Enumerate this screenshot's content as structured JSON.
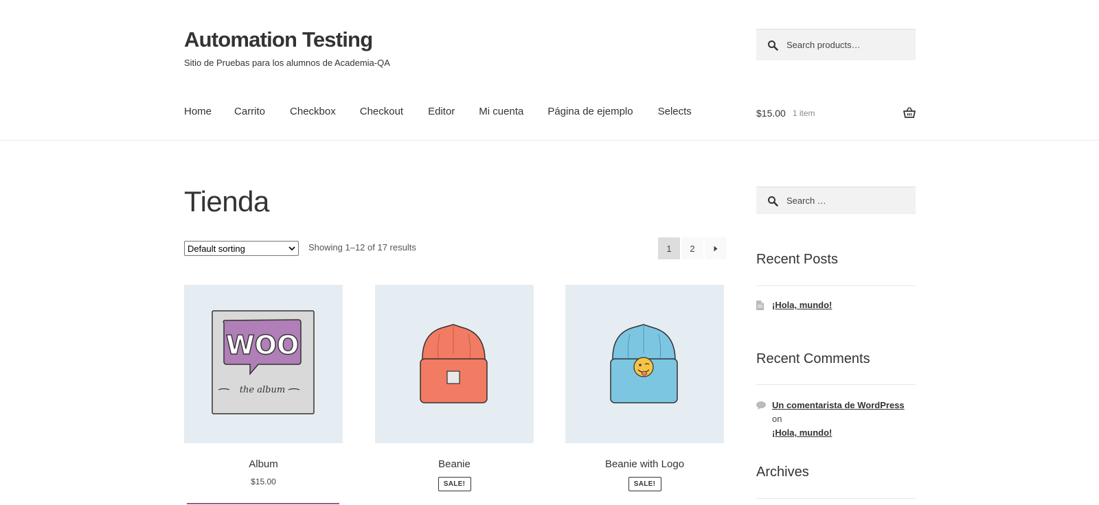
{
  "site": {
    "title": "Automation Testing",
    "tagline": "Sitio de Pruebas para los alumnos de Academia-QA"
  },
  "header_search": {
    "placeholder": "Search products…"
  },
  "nav": {
    "items": [
      "Home",
      "Carrito",
      "Checkbox",
      "Checkout",
      "Editor",
      "Mi cuenta",
      "Página de ejemplo",
      "Selects"
    ]
  },
  "cart": {
    "amount": "$15.00",
    "count": "1 item"
  },
  "shop": {
    "title": "Tienda",
    "sort_selected": "Default sorting",
    "result_count": "Showing 1–12 of 17 results",
    "pagination": [
      "1",
      "2"
    ]
  },
  "products": [
    {
      "name": "Album",
      "price": "$15.00"
    },
    {
      "name": "Beanie",
      "badge": "SALE!"
    },
    {
      "name": "Beanie with Logo",
      "badge": "SALE!"
    }
  ],
  "thumb_art": {
    "album_word": "WOO",
    "album_caption": "the album"
  },
  "sidebar": {
    "search_placeholder": "Search …",
    "recent_posts_title": "Recent Posts",
    "recent_posts": [
      "¡Hola, mundo!"
    ],
    "recent_comments_title": "Recent Comments",
    "comment": {
      "author": "Un comentarista de WordPress",
      "connector": "on",
      "post": "¡Hola, mundo!"
    },
    "archives_title": "Archives"
  },
  "colors": {
    "woo_purple": "#96588a",
    "thumb_bg": "#e6edf2",
    "beanie_orange": "#f27b63",
    "beanie_blue": "#7cc6e2"
  }
}
